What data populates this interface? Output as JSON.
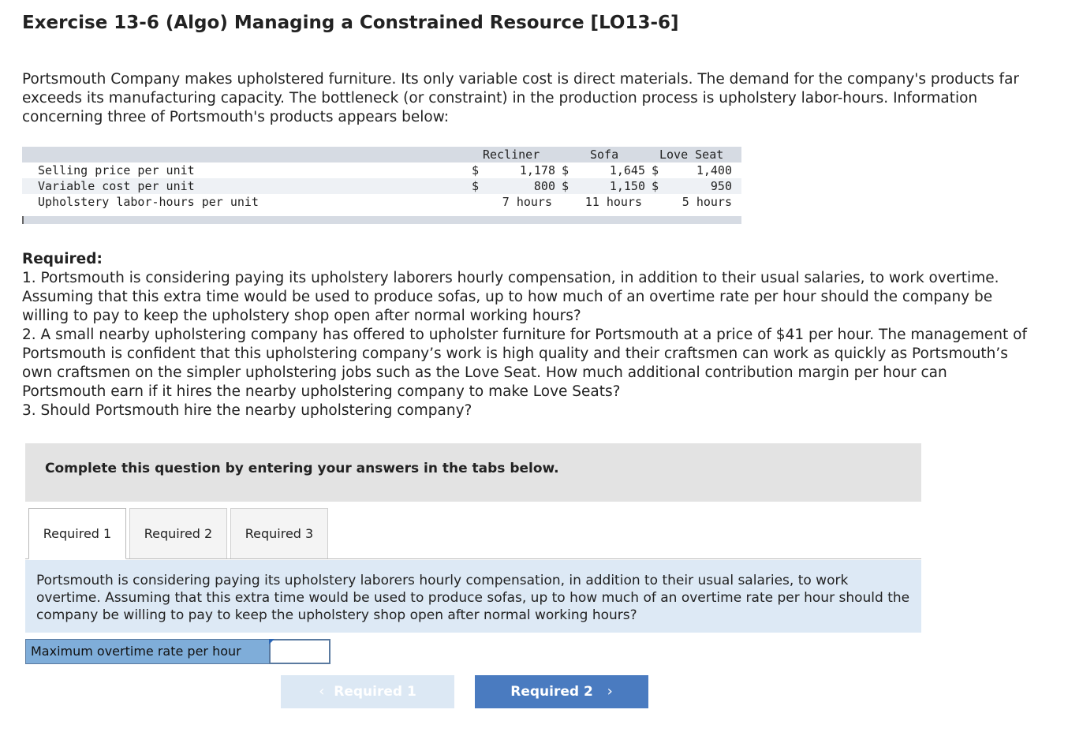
{
  "title": "Exercise 13-6 (Algo) Managing a Constrained Resource [LO13-6]",
  "intro": "Portsmouth Company makes upholstered furniture. Its only variable cost is direct materials. The demand for the company's products far exceeds its manufacturing capacity. The bottleneck (or constraint) in the production process is upholstery labor-hours. Information concerning three of Portsmouth's products appears below:",
  "table": {
    "headers": [
      "Recliner",
      "Sofa",
      "Love Seat"
    ],
    "rows": [
      {
        "label": "Selling price per unit",
        "sym1": "$",
        "v1": "1,178",
        "sym2": "$",
        "v2": "1,645",
        "sym3": "$",
        "v3": "1,400"
      },
      {
        "label": "Variable cost per unit",
        "sym1": "$",
        "v1": "800",
        "sym2": "$",
        "v2": "1,150",
        "sym3": "$",
        "v3": "950"
      },
      {
        "label": "Upholstery labor-hours per unit",
        "sym1": "",
        "v1": "7 hours",
        "sym2": "",
        "v2": "11 hours",
        "sym3": "",
        "v3": "5 hours"
      }
    ]
  },
  "required": {
    "heading": "Required:",
    "items": [
      "1. Portsmouth is considering paying its upholstery laborers hourly compensation, in addition to their usual salaries, to work overtime. Assuming that this extra time would be used to produce sofas, up to how much of an overtime rate per hour should the company be willing to pay to keep the upholstery shop open after normal working hours?",
      "2.  A small nearby upholstering company has offered to upholster furniture for Portsmouth at a price of $41 per hour. The management of Portsmouth is confident that this upholstering company’s work is high quality and their craftsmen can work as quickly as Portsmouth’s own craftsmen on the simpler upholstering jobs such as the Love Seat. How much additional contribution margin per hour can Portsmouth earn if it hires the nearby upholstering company to make Love Seats?",
      "3. Should Portsmouth hire the nearby upholstering company?"
    ]
  },
  "instructions": "Complete this question by entering your answers in the tabs below.",
  "tabs": [
    "Required 1",
    "Required 2",
    "Required 3"
  ],
  "active_tab": "Required 1",
  "question": "Portsmouth is considering paying its upholstery laborers hourly compensation, in addition to their usual salaries, to work overtime. Assuming that this extra time would be used to produce sofas, up to how much of an overtime rate per hour should the company be willing to pay to keep the upholstery shop open after normal working hours?",
  "answer": {
    "label": "Maximum overtime rate per hour",
    "value": ""
  },
  "nav": {
    "prev_label": "Required 1",
    "next_label": "Required 2",
    "prev_icon": "chevron-left-icon",
    "next_icon": "chevron-right-icon"
  }
}
